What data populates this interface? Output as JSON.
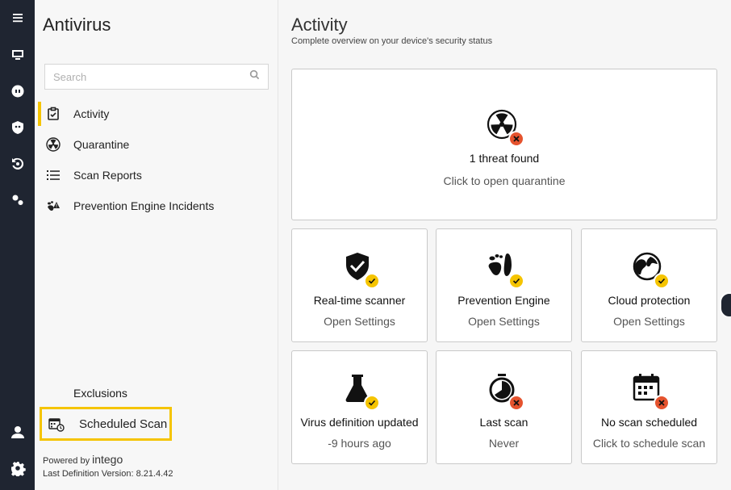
{
  "sidebar": {
    "title": "Antivirus",
    "search_placeholder": "Search",
    "items": [
      {
        "label": "Activity",
        "icon": "clipboard-check-icon",
        "active": true
      },
      {
        "label": "Quarantine",
        "icon": "radiation-icon"
      },
      {
        "label": "Scan Reports",
        "icon": "list-icon"
      },
      {
        "label": "Prevention Engine Incidents",
        "icon": "footprint-alert-icon"
      }
    ],
    "exclusions_label": "Exclusions",
    "scheduled_scan_label": "Scheduled Scan",
    "powered_by": "Powered by",
    "brand": "intego",
    "definition_version": "Last Definition Version:  8.21.4.42"
  },
  "main": {
    "title": "Activity",
    "subtitle": "Complete overview on your device's security status",
    "threat_card": {
      "title": "1 threat found",
      "subtitle": "Click to open quarantine"
    },
    "cards": [
      {
        "title": "Real-time scanner",
        "subtitle": "Open Settings",
        "status": "ok"
      },
      {
        "title": "Prevention Engine",
        "subtitle": "Open Settings",
        "status": "ok"
      },
      {
        "title": "Cloud protection",
        "subtitle": "Open Settings",
        "status": "ok"
      },
      {
        "title": "Virus definition updated",
        "subtitle": "-9 hours ago",
        "status": "ok"
      },
      {
        "title": "Last scan",
        "subtitle": "Never",
        "status": "bad"
      },
      {
        "title": "No scan scheduled",
        "subtitle": "Click to schedule scan",
        "status": "bad"
      }
    ]
  },
  "colors": {
    "accent": "#f5c400",
    "alert": "#e5532e",
    "rail": "#1f2531"
  }
}
